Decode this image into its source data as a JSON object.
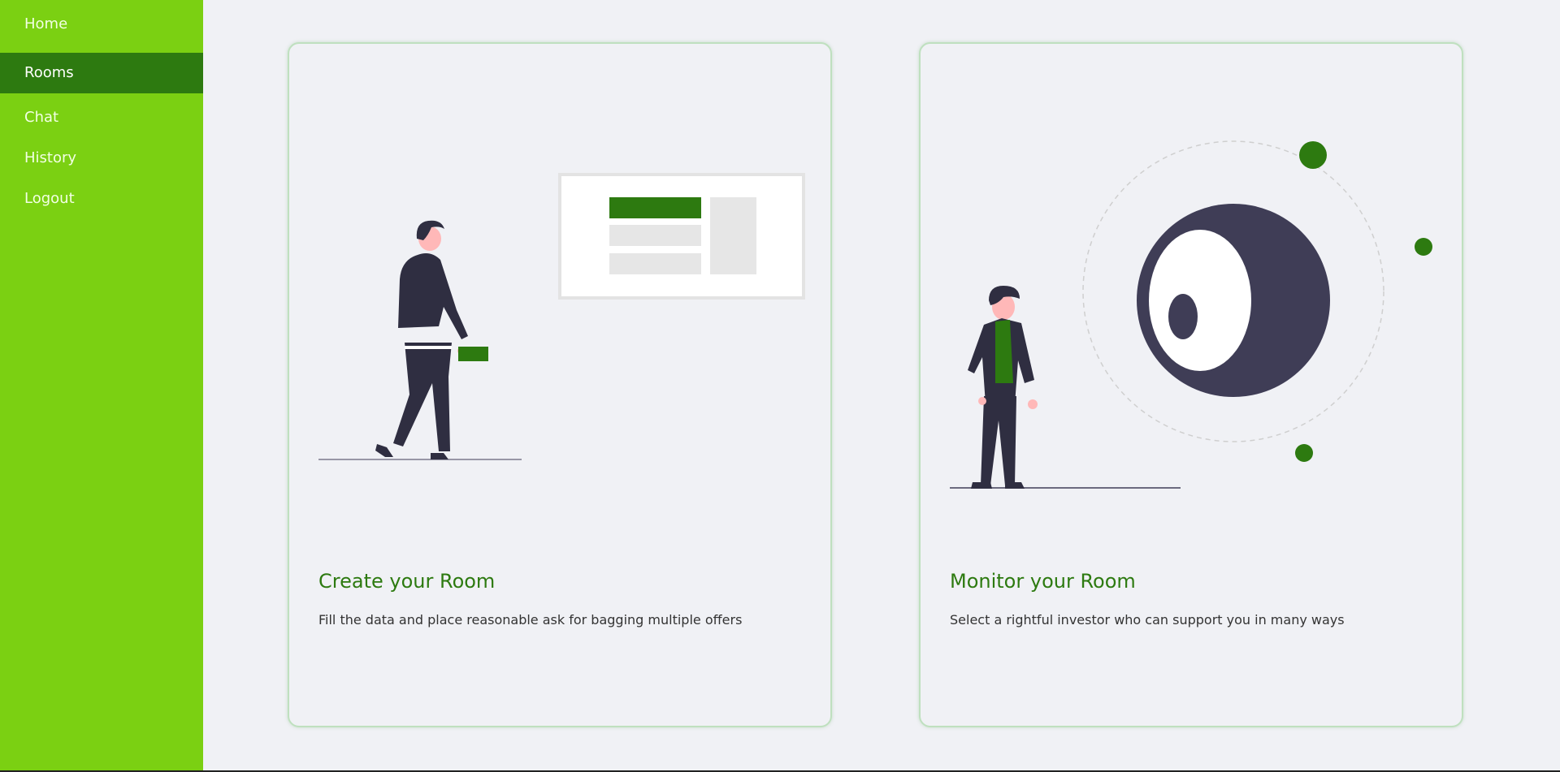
{
  "sidebar": {
    "items": [
      {
        "label": "Home",
        "active": false
      },
      {
        "label": "Rooms",
        "active": true
      },
      {
        "label": "Chat",
        "active": false
      },
      {
        "label": "History",
        "active": false
      },
      {
        "label": "Logout",
        "active": false
      }
    ]
  },
  "cards": [
    {
      "title": "Create your Room",
      "description": "Fill the data and place reasonable ask for bagging multiple offers"
    },
    {
      "title": "Monitor your Room",
      "description": "Select a rightful investor who can support you in many ways"
    }
  ],
  "colors": {
    "sidebar": "#7bd012",
    "active": "#2d7a10",
    "accent": "#2d7a10",
    "figure": "#2f2e41"
  }
}
